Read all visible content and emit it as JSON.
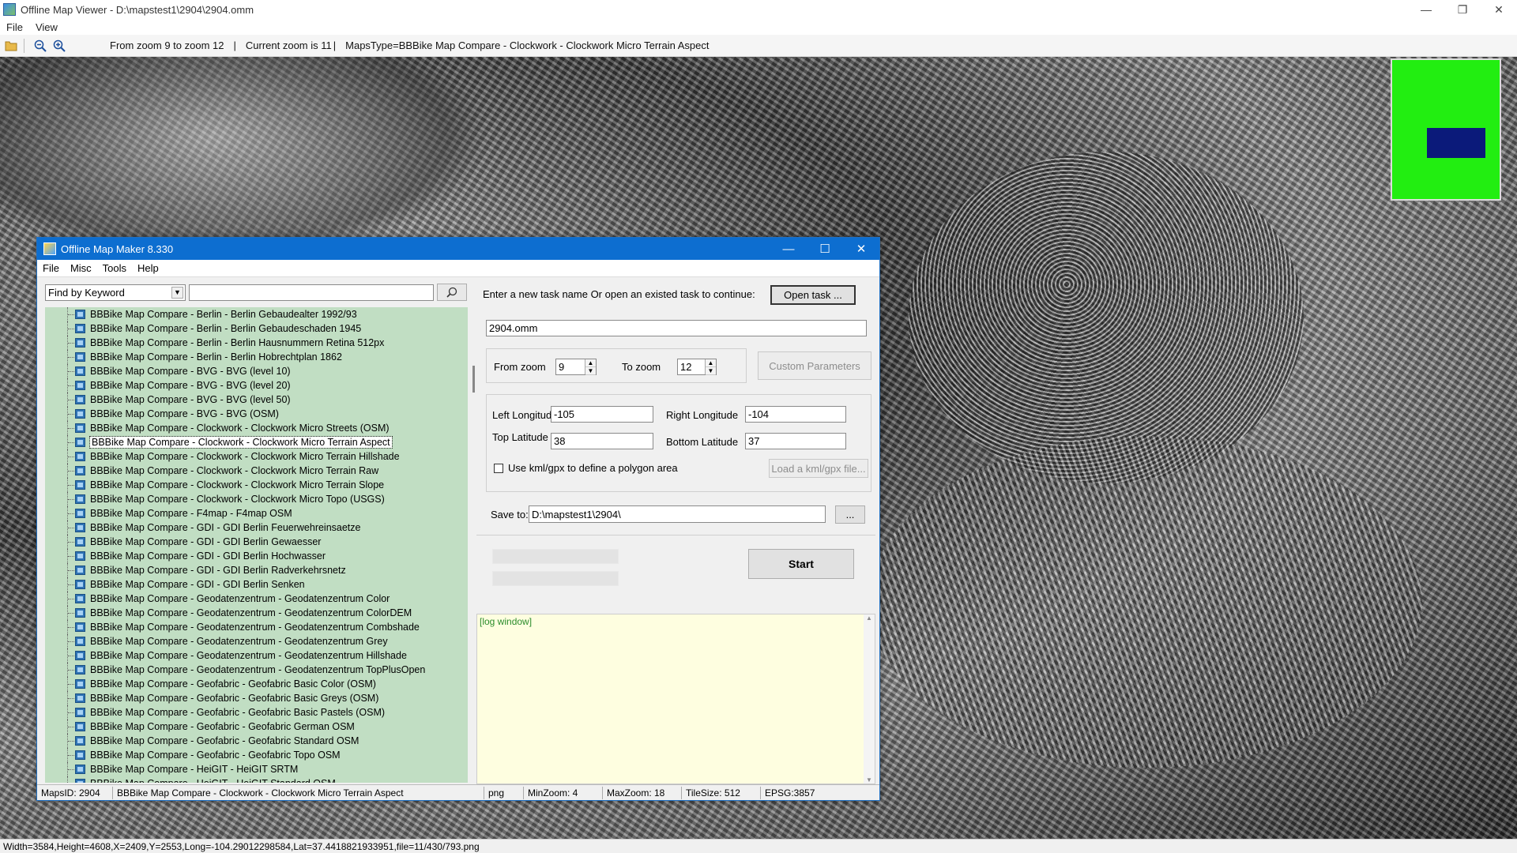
{
  "window": {
    "title": "Offline Map Viewer - D:\\mapstest1\\2904\\2904.omm",
    "controls": {
      "minimize": "—",
      "restore": "❐",
      "close": "✕"
    }
  },
  "menu": [
    "File",
    "View"
  ],
  "toolbar": {
    "zoom_range": "From zoom 9 to zoom 12",
    "current_zoom": "Current zoom is 11",
    "maps_type": "MapsType=BBBike Map Compare - Clockwork - Clockwork Micro Terrain Aspect"
  },
  "status_bar": "Width=3584,Height=4608,X=2409,Y=2553,Long=-104.29012298584,Lat=37.4418821933951,file=11/430/793.png",
  "colors": {
    "overview_bg": "#22ee11",
    "overview_viewport": "#0b1a7a",
    "dialog_title": "#0d6ed0",
    "tree_bg": "#c1dec3",
    "log_bg": "#fefee0"
  },
  "dialog": {
    "title": "Offline Map Maker 8.330",
    "controls": {
      "minimize": "—",
      "maximize": "☐",
      "close": "✕"
    },
    "menu": [
      "File",
      "Misc",
      "Tools",
      "Help"
    ],
    "search": {
      "mode": "Find by Keyword",
      "value": "",
      "button_icon": "search-icon"
    },
    "tree_items": [
      "BBBike Map Compare - Berlin - Berlin Gebaudealter 1992/93",
      "BBBike Map Compare - Berlin - Berlin Gebaudeschaden 1945",
      "BBBike Map Compare - Berlin - Berlin Hausnummern Retina 512px",
      "BBBike Map Compare - Berlin - Berlin Hobrechtplan 1862",
      "BBBike Map Compare - BVG - BVG (level 10)",
      "BBBike Map Compare - BVG - BVG (level 20)",
      "BBBike Map Compare - BVG - BVG (level 50)",
      "BBBike Map Compare - BVG - BVG (OSM)",
      "BBBike Map Compare - Clockwork - Clockwork Micro Streets (OSM)",
      "BBBike Map Compare - Clockwork - Clockwork Micro Terrain Aspect",
      "BBBike Map Compare - Clockwork - Clockwork Micro Terrain Hillshade",
      "BBBike Map Compare - Clockwork - Clockwork Micro Terrain Raw",
      "BBBike Map Compare - Clockwork - Clockwork Micro Terrain Slope",
      "BBBike Map Compare - Clockwork - Clockwork Micro Topo (USGS)",
      "BBBike Map Compare - F4map - F4map OSM",
      "BBBike Map Compare - GDI - GDI Berlin Feuerwehreinsaetze",
      "BBBike Map Compare - GDI - GDI Berlin Gewaesser",
      "BBBike Map Compare - GDI - GDI Berlin Hochwasser",
      "BBBike Map Compare - GDI - GDI Berlin Radverkehrsnetz",
      "BBBike Map Compare - GDI - GDI Berlin Senken",
      "BBBike Map Compare - Geodatenzentrum - Geodatenzentrum Color",
      "BBBike Map Compare - Geodatenzentrum - Geodatenzentrum ColorDEM",
      "BBBike Map Compare - Geodatenzentrum - Geodatenzentrum Combshade",
      "BBBike Map Compare - Geodatenzentrum - Geodatenzentrum Grey",
      "BBBike Map Compare - Geodatenzentrum - Geodatenzentrum Hillshade",
      "BBBike Map Compare - Geodatenzentrum - Geodatenzentrum TopPlusOpen",
      "BBBike Map Compare - Geofabric - Geofabric Basic Color (OSM)",
      "BBBike Map Compare - Geofabric - Geofabric Basic Greys (OSM)",
      "BBBike Map Compare - Geofabric - Geofabric Basic Pastels (OSM)",
      "BBBike Map Compare - Geofabric - Geofabric German OSM",
      "BBBike Map Compare - Geofabric - Geofabric Standard OSM",
      "BBBike Map Compare - Geofabric - Geofabric Topo OSM",
      "BBBike Map Compare - HeiGIT - HeiGIT SRTM",
      "BBBike Map Compare - HeiGIT - HeiGIT Standard OSM"
    ],
    "selected_index": 9,
    "task": {
      "prompt": "Enter a new task name Or open an existed task to continue:",
      "open_button": "Open task ...",
      "name": "2904.omm"
    },
    "zoom": {
      "from_label": "From zoom",
      "from_value": "9",
      "to_label": "To zoom",
      "to_value": "12",
      "custom_button": "Custom Parameters"
    },
    "coords": {
      "left_lon_label": "Left Longitude",
      "left_lon": "-105",
      "right_lon_label": "Right Longitude",
      "right_lon": "-104",
      "top_lat_label": "Top Latitude",
      "top_lat": "38",
      "bottom_lat_label": "Bottom Latitude",
      "bottom_lat": "37",
      "kml_label": "Use kml/gpx to define a polygon area",
      "kml_checked": false,
      "kml_button": "Load a kml/gpx file..."
    },
    "save": {
      "label": "Save to:",
      "path": "D:\\mapstest1\\2904\\",
      "browse_button": "..."
    },
    "start_button": "Start",
    "log_text": "[log window]",
    "status": {
      "maps_id": "MapsID: 2904",
      "map_name": "BBBike Map Compare - Clockwork - Clockwork Micro Terrain Aspect",
      "format": "png",
      "min_zoom": "MinZoom: 4",
      "max_zoom": "MaxZoom: 18",
      "tile_size": "TileSize: 512",
      "epsg": "EPSG:3857"
    }
  }
}
